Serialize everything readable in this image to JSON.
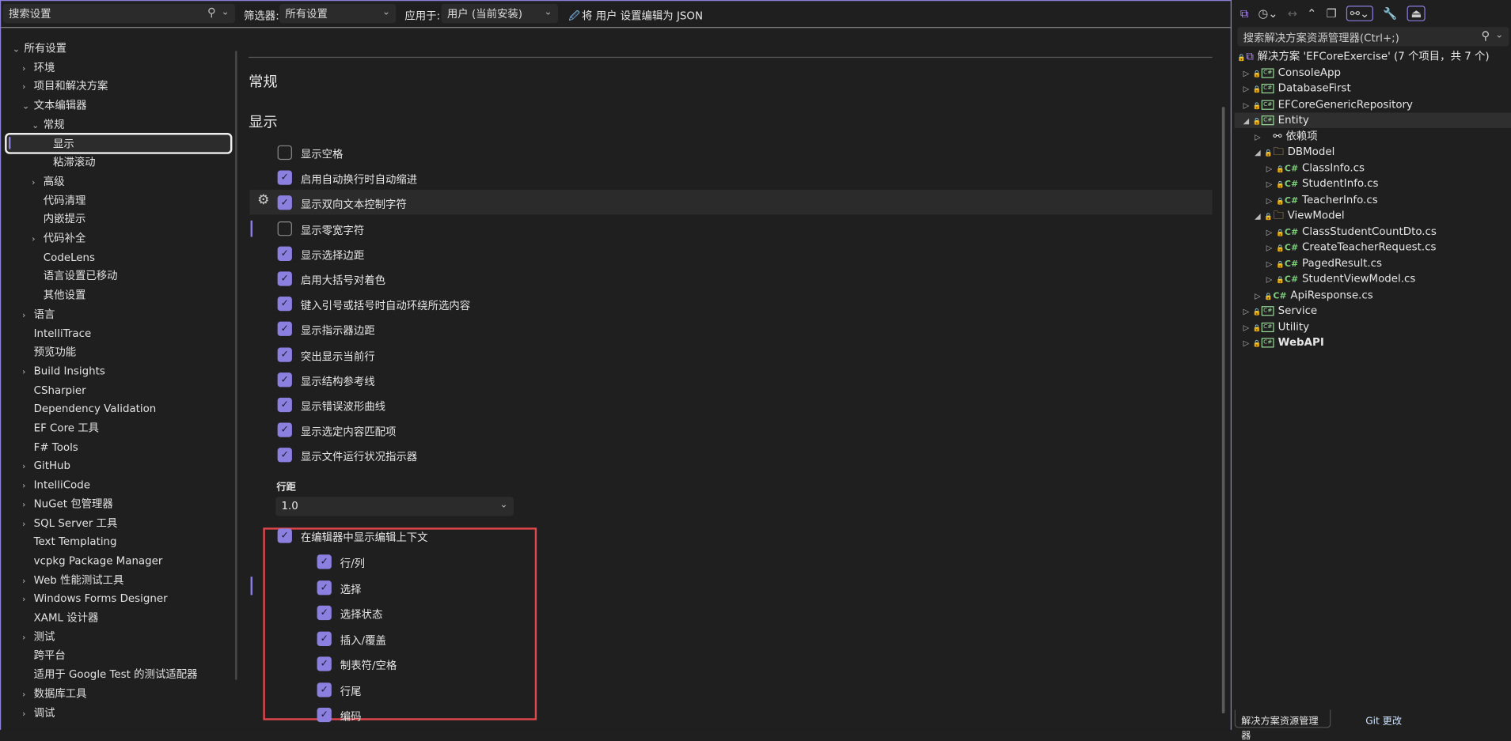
{
  "toolbar": {
    "search_placeholder": "搜索设置",
    "filter_label": "筛选器:",
    "filter_value": "所有设置",
    "apply_label": "应用于:",
    "apply_value": "用户 (当前安装)",
    "json_link": "将 用户 设置编辑为 JSON"
  },
  "nav_tree": [
    {
      "label": "所有设置",
      "level": 0,
      "tw": "down"
    },
    {
      "label": "环境",
      "level": 1,
      "tw": "right"
    },
    {
      "label": "项目和解决方案",
      "level": 1,
      "tw": "right"
    },
    {
      "label": "文本编辑器",
      "level": 1,
      "tw": "down"
    },
    {
      "label": "常规",
      "level": 2,
      "tw": "down"
    },
    {
      "label": "显示",
      "level": 3,
      "tw": "",
      "selected": true
    },
    {
      "label": "粘滞滚动",
      "level": 3,
      "tw": ""
    },
    {
      "label": "高级",
      "level": 2,
      "tw": "right"
    },
    {
      "label": "代码清理",
      "level": 2,
      "tw": ""
    },
    {
      "label": "内嵌提示",
      "level": 2,
      "tw": ""
    },
    {
      "label": "代码补全",
      "level": 2,
      "tw": "right"
    },
    {
      "label": "CodeLens",
      "level": 2,
      "tw": ""
    },
    {
      "label": "语言设置已移动",
      "level": 2,
      "tw": ""
    },
    {
      "label": "其他设置",
      "level": 2,
      "tw": ""
    },
    {
      "label": "语言",
      "level": 1,
      "tw": "right"
    },
    {
      "label": "IntelliTrace",
      "level": 1,
      "tw": ""
    },
    {
      "label": "预览功能",
      "level": 1,
      "tw": ""
    },
    {
      "label": "Build Insights",
      "level": 1,
      "tw": "right"
    },
    {
      "label": "CSharpier",
      "level": 1,
      "tw": ""
    },
    {
      "label": "Dependency Validation",
      "level": 1,
      "tw": ""
    },
    {
      "label": "EF Core 工具",
      "level": 1,
      "tw": ""
    },
    {
      "label": "F# Tools",
      "level": 1,
      "tw": ""
    },
    {
      "label": "GitHub",
      "level": 1,
      "tw": "right"
    },
    {
      "label": "IntelliCode",
      "level": 1,
      "tw": "right"
    },
    {
      "label": "NuGet 包管理器",
      "level": 1,
      "tw": "right"
    },
    {
      "label": "SQL Server 工具",
      "level": 1,
      "tw": "right"
    },
    {
      "label": "Text Templating",
      "level": 1,
      "tw": ""
    },
    {
      "label": "vcpkg Package Manager",
      "level": 1,
      "tw": ""
    },
    {
      "label": "Web 性能测试工具",
      "level": 1,
      "tw": "right"
    },
    {
      "label": "Windows Forms Designer",
      "level": 1,
      "tw": "right"
    },
    {
      "label": "XAML 设计器",
      "level": 1,
      "tw": ""
    },
    {
      "label": "测试",
      "level": 1,
      "tw": "right"
    },
    {
      "label": "跨平台",
      "level": 1,
      "tw": ""
    },
    {
      "label": "适用于 Google Test 的测试适配器",
      "level": 1,
      "tw": ""
    },
    {
      "label": "数据库工具",
      "level": 1,
      "tw": "right"
    },
    {
      "label": "调试",
      "level": 1,
      "tw": "right"
    }
  ],
  "main": {
    "section_title": "常规",
    "group_title": "显示",
    "options": [
      {
        "label": "显示空格",
        "checked": false
      },
      {
        "label": "启用自动换行时自动缩进",
        "checked": true
      },
      {
        "label": "显示双向文本控制字符",
        "checked": true,
        "hovered": true
      },
      {
        "label": "显示零宽字符",
        "checked": false
      },
      {
        "label": "显示选择边距",
        "checked": true
      },
      {
        "label": "启用大括号对着色",
        "checked": true
      },
      {
        "label": "键入引号或括号时自动环绕所选内容",
        "checked": true
      },
      {
        "label": "显示指示器边距",
        "checked": true
      },
      {
        "label": "突出显示当前行",
        "checked": true
      },
      {
        "label": "显示结构参考线",
        "checked": true
      },
      {
        "label": "显示错误波形曲线",
        "checked": true
      },
      {
        "label": "显示选定内容匹配项",
        "checked": true
      },
      {
        "label": "显示文件运行状况指示器",
        "checked": true
      }
    ],
    "line_spacing_label": "行距",
    "line_spacing_value": "1.0",
    "context": {
      "label": "在编辑器中显示编辑上下文",
      "checked": true
    },
    "context_children": [
      {
        "label": "行/列",
        "checked": true
      },
      {
        "label": "选择",
        "checked": true
      },
      {
        "label": "选择状态",
        "checked": true
      },
      {
        "label": "插入/覆盖",
        "checked": true
      },
      {
        "label": "制表符/空格",
        "checked": true
      },
      {
        "label": "行尾",
        "checked": true
      },
      {
        "label": "编码",
        "checked": true
      }
    ]
  },
  "solution_explorer": {
    "search_placeholder": "搜索解决方案资源管理器(Ctrl+;)",
    "items": [
      {
        "label": "解决方案 'EFCoreExercise' (7 个项目，共 7 个)",
        "level": 0,
        "tw": "",
        "icon": "solution"
      },
      {
        "label": "ConsoleApp",
        "level": 0,
        "tw": "right",
        "icon": "csproj"
      },
      {
        "label": "DatabaseFirst",
        "level": 0,
        "tw": "right",
        "icon": "csproj"
      },
      {
        "label": "EFCoreGenericRepository",
        "level": 0,
        "tw": "right",
        "icon": "csproj"
      },
      {
        "label": "Entity",
        "level": 0,
        "tw": "down",
        "icon": "csproj",
        "selected": true
      },
      {
        "label": "依赖项",
        "level": 1,
        "tw": "right",
        "icon": "dependencies"
      },
      {
        "label": "DBModel",
        "level": 1,
        "tw": "down",
        "icon": "folder"
      },
      {
        "label": "ClassInfo.cs",
        "level": 2,
        "tw": "right",
        "icon": "csfile"
      },
      {
        "label": "StudentInfo.cs",
        "level": 2,
        "tw": "right",
        "icon": "csfile"
      },
      {
        "label": "TeacherInfo.cs",
        "level": 2,
        "tw": "right",
        "icon": "csfile"
      },
      {
        "label": "ViewModel",
        "level": 1,
        "tw": "down",
        "icon": "folder"
      },
      {
        "label": "ClassStudentCountDto.cs",
        "level": 2,
        "tw": "right",
        "icon": "csfile"
      },
      {
        "label": "CreateTeacherRequest.cs",
        "level": 2,
        "tw": "right",
        "icon": "csfile"
      },
      {
        "label": "PagedResult.cs",
        "level": 2,
        "tw": "right",
        "icon": "csfile"
      },
      {
        "label": "StudentViewModel.cs",
        "level": 2,
        "tw": "right",
        "icon": "csfile"
      },
      {
        "label": "ApiResponse.cs",
        "level": 1,
        "tw": "right",
        "icon": "csfile"
      },
      {
        "label": "Service",
        "level": 0,
        "tw": "right",
        "icon": "csproj"
      },
      {
        "label": "Utility",
        "level": 0,
        "tw": "right",
        "icon": "csproj"
      },
      {
        "label": "WebAPI",
        "level": 0,
        "tw": "right",
        "icon": "csproj",
        "bold": true
      }
    ],
    "tabs": [
      {
        "label": "解决方案资源管理器",
        "active": true
      },
      {
        "label": "Git 更改",
        "active": false
      }
    ]
  },
  "colors": {
    "accent": "#8b7fe0",
    "highlight_box": "#e0464b",
    "lock": "#4ea3ff"
  }
}
